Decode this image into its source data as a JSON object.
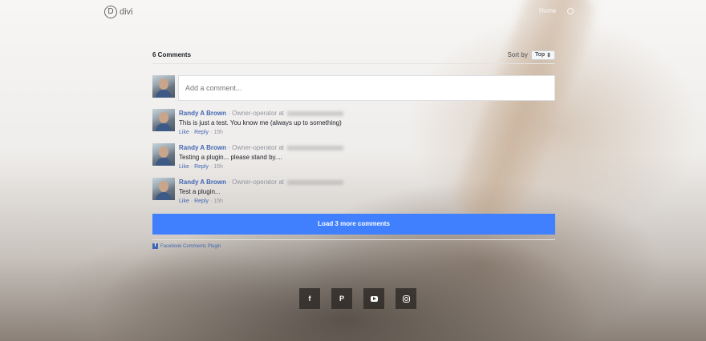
{
  "header": {
    "logo_letter": "D",
    "logo_text": "divi",
    "nav_home": "Home"
  },
  "comments_plugin": {
    "count_label": "6 Comments",
    "sort_label": "Sort by",
    "sort_value": "Top",
    "compose_placeholder": "Add a comment...",
    "comments": [
      {
        "author": "Randy A Brown",
        "role": "· Owner-operator at",
        "text": "This is just a test. You know me (always up to something)",
        "like": "Like",
        "reply": "Reply",
        "time": "15h"
      },
      {
        "author": "Randy A Brown",
        "role": "· Owner-operator at",
        "text": "Testing a plugin... please stand by....",
        "like": "Like",
        "reply": "Reply",
        "time": "15h"
      },
      {
        "author": "Randy A Brown",
        "role": "· Owner-operator at",
        "text": "Test a plugin...",
        "like": "Like",
        "reply": "Reply",
        "time": "15h"
      }
    ],
    "load_more_label": "Load 3 more comments",
    "footer_label": "Facebook Comments Plugin",
    "accent_color": "#4080ff",
    "link_color": "#4267b2"
  },
  "socials": {
    "facebook": "f",
    "pinterest": "P"
  }
}
